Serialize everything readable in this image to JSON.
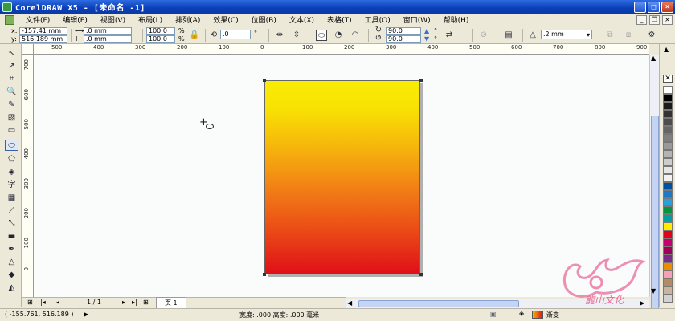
{
  "window": {
    "title": "CorelDRAW X5 - [未命名 -1]",
    "minimize": "_",
    "maximize": "□",
    "close": "×"
  },
  "menu": {
    "items": [
      "文件(F)",
      "编辑(E)",
      "视图(V)",
      "布局(L)",
      "排列(A)",
      "效果(C)",
      "位图(B)",
      "文本(X)",
      "表格(T)",
      "工具(O)",
      "窗口(W)",
      "帮助(H)"
    ]
  },
  "property_bar": {
    "x_label": "x:",
    "x_value": "-157.41 mm",
    "y_label": "y:",
    "y_value": "516.189 mm",
    "width_value": ".0 mm",
    "height_value": ".0 mm",
    "scale_x": "100.0",
    "scale_y": "100.0",
    "percent": "%",
    "rotation": ".0",
    "degree": "°",
    "start_angle": "90.0",
    "end_angle": "90.0",
    "outline_width": ".2 mm"
  },
  "rulers": {
    "h_ticks": [
      "500",
      "400",
      "300",
      "200",
      "100",
      "0",
      "100",
      "200",
      "300",
      "400",
      "500",
      "600",
      "700",
      "800",
      "900"
    ],
    "v_ticks": [
      "700",
      "600",
      "500",
      "400",
      "300",
      "200",
      "100",
      "0"
    ],
    "units": "毫米"
  },
  "canvas": {
    "object": "gradient-rectangle",
    "gradient_colors": [
      "#f8ec03",
      "#f6b40c",
      "#f28116",
      "#ea4a16",
      "#e00f18"
    ]
  },
  "page_nav": {
    "page_count": "1 / 1",
    "page_tab": "页 1"
  },
  "status": {
    "coords": "( -155.761, 516.189 )",
    "dimensions": "宽度: .000  高度: .000  毫米",
    "fill_label": "渐变"
  },
  "palette_colors": [
    "#ffffff",
    "#000000",
    "#1a1a1a",
    "#333333",
    "#4d4d4d",
    "#666666",
    "#808080",
    "#999999",
    "#b3b3b3",
    "#cccccc",
    "#e6e6e6",
    "#f2f2f2",
    "#0050a0",
    "#1e78c8",
    "#2aa0d8",
    "#009640",
    "#00a0a0",
    "#ffea00",
    "#e2001a",
    "#c8006e",
    "#a0005a",
    "#7d2a8c",
    "#f08c00",
    "#f5a0b4",
    "#b48c64",
    "#c8b4a0",
    "#d2d2d2"
  ],
  "watermark": {
    "text": "龍山文化"
  }
}
